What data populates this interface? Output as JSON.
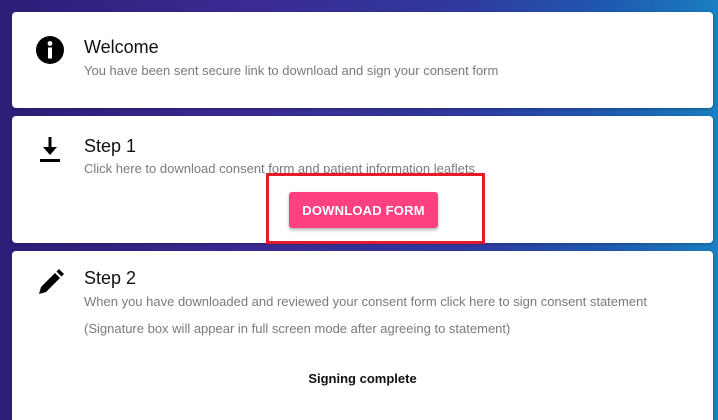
{
  "welcome": {
    "icon": "info-icon",
    "title": "Welcome",
    "description": "You have been sent secure link to download and sign your consent form"
  },
  "step1": {
    "icon": "download-icon",
    "title": "Step 1",
    "description": "Click here to download consent form and patient information leaflets",
    "button_label": "DOWNLOAD FORM"
  },
  "step2": {
    "icon": "pencil-icon",
    "title": "Step 2",
    "description1": "When you have downloaded and reviewed your consent form click here to sign consent statement",
    "description2": "(Signature box will appear in full screen mode after agreeing to statement)",
    "status": "Signing complete"
  },
  "colors": {
    "accent": "#ff4081",
    "highlight": "#e41b2b"
  }
}
